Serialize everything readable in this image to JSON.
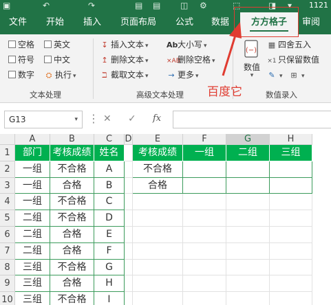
{
  "title_bar": {
    "text": "1121"
  },
  "tabs": [
    {
      "id": "file",
      "label": "文件"
    },
    {
      "id": "start",
      "label": "开始"
    },
    {
      "id": "insert",
      "label": "插入"
    },
    {
      "id": "layout",
      "label": "页面布局"
    },
    {
      "id": "formula",
      "label": "公式"
    },
    {
      "id": "data",
      "label": "数据"
    },
    {
      "id": "ffgz",
      "label": "方方格子"
    },
    {
      "id": "review",
      "label": "审阅"
    }
  ],
  "ribbon": {
    "text_group": {
      "items": [
        "空格",
        "英文",
        "符号",
        "中文",
        "数字",
        "执行"
      ],
      "label": "文本处理"
    },
    "adv_group": {
      "items": [
        "插入文本",
        "大小写",
        "删除文本",
        "删除空格",
        "截取文本",
        "更多"
      ],
      "label": "高级文本处理"
    },
    "num_group": {
      "value_label": "数值",
      "round_label": "四舍五入",
      "keep_label": "只保留数值",
      "label": "数值录入"
    }
  },
  "annotation": {
    "text": "百度它"
  },
  "formula_bar": {
    "name_box": "G13",
    "fx": "fx"
  },
  "sheet": {
    "col_headers": [
      "A",
      "B",
      "C",
      "D",
      "E",
      "F",
      "G",
      "H"
    ],
    "row_headers": [
      "1",
      "2",
      "3",
      "4",
      "5",
      "6",
      "7",
      "8",
      "9",
      "10"
    ],
    "selected_column": "G",
    "left_header": [
      "部门",
      "考核成绩",
      "姓名"
    ],
    "left_rows": [
      [
        "一组",
        "不合格",
        "A"
      ],
      [
        "一组",
        "合格",
        "B"
      ],
      [
        "一组",
        "不合格",
        "C"
      ],
      [
        "二组",
        "不合格",
        "D"
      ],
      [
        "二组",
        "合格",
        "E"
      ],
      [
        "二组",
        "合格",
        "F"
      ],
      [
        "三组",
        "不合格",
        "G"
      ],
      [
        "三组",
        "合格",
        "H"
      ],
      [
        "三组",
        "不合格",
        "I"
      ]
    ],
    "right_header": [
      "考核成绩",
      "一组",
      "二组",
      "三组"
    ],
    "right_rows": [
      "不合格",
      "合格"
    ]
  }
}
